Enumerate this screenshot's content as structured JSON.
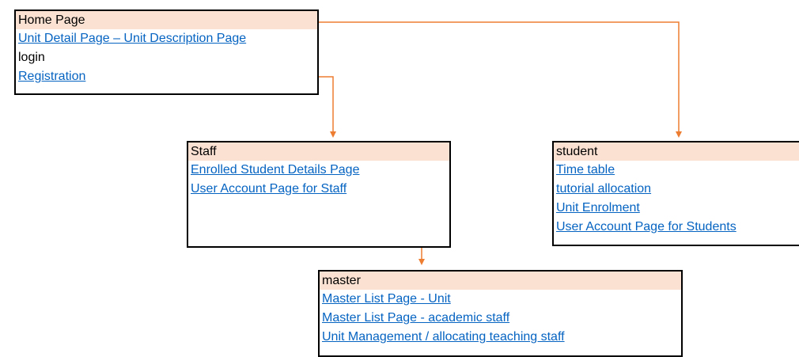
{
  "colors": {
    "header_fill": "#fbe1d2",
    "link": "#0563c1",
    "connector": "#ed7d31",
    "border": "#000000"
  },
  "home": {
    "title": "Home Page",
    "items": [
      {
        "label": "Unit Detail Page – Unit Description Page ",
        "link": true
      },
      {
        "label": "login",
        "link": false
      },
      {
        "label": "Registration",
        "link": true
      }
    ]
  },
  "staff": {
    "title": "Staff",
    "items": [
      {
        "label": "Enrolled Student Details Page",
        "link": true
      },
      {
        "label": "User Account Page for Staff ",
        "link": true
      }
    ]
  },
  "student": {
    "title": "student",
    "items": [
      {
        "label": "Time table ",
        "link": true
      },
      {
        "label": "tutorial allocation",
        "link": true
      },
      {
        "label": "Unit Enrolment",
        "link": true
      },
      {
        "label": "User Account Page for Students ",
        "link": true
      }
    ]
  },
  "master": {
    "title": "master",
    "items": [
      {
        "label": "Master List Page - Unit ",
        "link": true
      },
      {
        "label": "Master List Page - academic staff ",
        "link": true
      },
      {
        "label": "Unit Management / allocating teaching staff",
        "link": true
      }
    ]
  }
}
